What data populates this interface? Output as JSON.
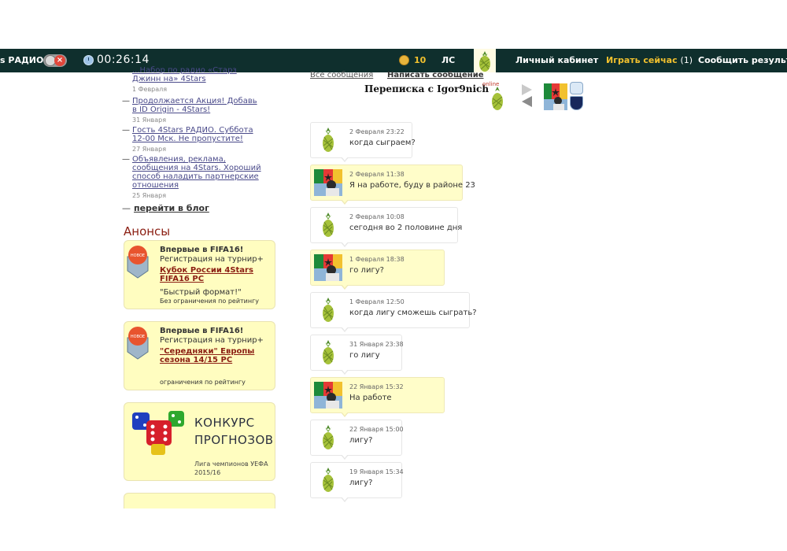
{
  "topbar": {
    "radio_label": "s РАДИО",
    "timer": "00:26:14",
    "coins": "10",
    "messages_label": "ЛС",
    "nav": {
      "cabinet": "Личный кабинет",
      "play_now": "Играть сейчас",
      "play_now_count": "(1)",
      "report_result": "Сообщить результат"
    },
    "icons": [
      "radio-toggle-icon",
      "clock-icon",
      "coin-icon",
      "user-avatar-icon"
    ]
  },
  "sidebar": {
    "news": [
      {
        "title": "...Набор по радио «Старз Джинн на» 4Stars",
        "date": "1 Февраля"
      },
      {
        "title": "Продолжается Акция! Добавь в ID Origin - 4Stars!",
        "date": "31 Января"
      },
      {
        "title": "Гость 4Stars РАДИО. Суббота 12-00 Мск. Не пропустите!",
        "date": "27 Января"
      },
      {
        "title": "Объявления, реклама, сообщения на 4Stars. Хороший способ наладить партнерские отношения",
        "date": "25 Января"
      }
    ],
    "blog_link": "перейти в блог",
    "announcements_title": "Анонсы",
    "promos": [
      {
        "badge": "НОВОЕ",
        "title": "Впервые в FIFA16!",
        "subtitle": "Регистрация на турнир+",
        "link": "Кубок России 4Stars FIFA16 PC",
        "quote": "\"Быстрый формат!\"",
        "note": "Без ограничения по рейтингу"
      },
      {
        "badge": "НОВОЕ",
        "title": "Впервые в FIFA16!",
        "subtitle": "Регистрация на турнир+",
        "link": "\"Середняки\" Европы сезона 14/15 PC",
        "note": "ограничения по рейтингу"
      }
    ],
    "contest": {
      "line1": "КОНКУРС",
      "line2": "ПРОГНОЗОВ",
      "sub1": "Лига чемпионов УЕФА",
      "sub2": "2015/16"
    }
  },
  "conversation": {
    "tab_all": "Все сообщения",
    "tab_write": "Написать сообщение",
    "title": "Переписка с Igor9nich",
    "online": "online",
    "messages": [
      {
        "author": "Igor9nich",
        "time": "2 Февраля 23:22",
        "text": "когда сыграем?"
      },
      {
        "author": "me",
        "time": "2 Февраля 11:38",
        "text": "Я на работе, буду в районе 23"
      },
      {
        "author": "Igor9nich",
        "time": "2 Февраля 10:08",
        "text": "сегодня во 2 половине дня"
      },
      {
        "author": "me",
        "time": "1 Февраля 18:38",
        "text": "го лигу?"
      },
      {
        "author": "Igor9nich",
        "time": "1 Февраля 12:50",
        "text": "когда лигу сможешь сыграть?"
      },
      {
        "author": "Igor9nich",
        "time": "31 Января 23:38",
        "text": "го лигу"
      },
      {
        "author": "me",
        "time": "22 Января 15:32",
        "text": "На работе"
      },
      {
        "author": "Igor9nich",
        "time": "22 Января 15:00",
        "text": "лигу?"
      },
      {
        "author": "Igor9nich",
        "time": "19 Января 15:34",
        "text": "лигу?"
      }
    ]
  },
  "colors": {
    "topbar_bg": "#0f2f2d",
    "accent_yellow": "#f2c12e",
    "promo_bg": "#fffdc0",
    "link_red": "#8b1e12",
    "own_message_bg": "#fffdc9"
  }
}
